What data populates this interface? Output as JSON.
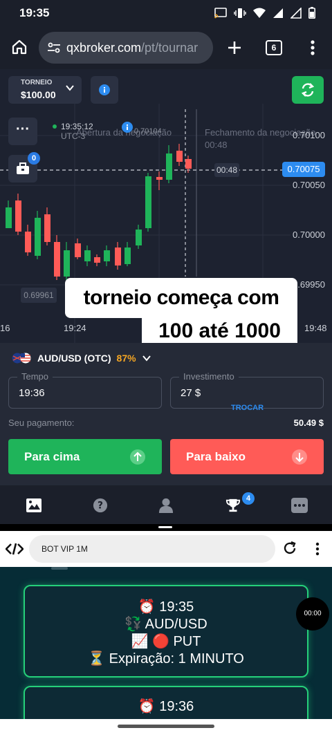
{
  "statusbar": {
    "time": "19:35"
  },
  "browser": {
    "host": "qxbroker.com",
    "path": "/pt/tournar",
    "tab_count": "6"
  },
  "trade": {
    "tournament_label": "TORNEIO",
    "tournament_balance": "$100.00",
    "notif_count": "0",
    "clock_time": "19:35:12",
    "clock_tz": "UTC-3",
    "open_label": "Abertura da negociação",
    "close_label": "Fechamento da negociação",
    "close_time": "00:48",
    "price_flag": "0.70104",
    "current_price": "0.70075",
    "time_badge": "00:48",
    "low_tag": "0.69961",
    "price_ticks": [
      "0.70100",
      "0.70050",
      "0.70000",
      "0.69950"
    ],
    "x_labels": [
      "16",
      "19:24",
      "19:48"
    ]
  },
  "overlay": {
    "line1": "torneio começa com",
    "line2": "100 até  1000"
  },
  "panel": {
    "pair": "AUD/USD (OTC)",
    "payout_pct": "87%",
    "time_label": "Tempo",
    "time_value": "19:36",
    "invest_label": "Investimento",
    "invest_value": "27 $",
    "switch_label": "TROCAR",
    "payment_label": "Seu pagamento:",
    "payment_value": "50.49 $",
    "up_label": "Para cima",
    "down_label": "Para baixo"
  },
  "nav": {
    "trophy_badge": "4"
  },
  "lower": {
    "url": "BOT VIP 1M",
    "timer": "00:00",
    "signal1": {
      "time": "⏰ 19:35",
      "pair": "💱 AUD/USD",
      "dir": "📈 🔴 PUT",
      "exp": "⏳ Expiração: 1 MINUTO"
    },
    "signal2": {
      "time": "⏰ 19:36"
    }
  },
  "colors": {
    "green": "#1fb45a",
    "red": "#ff5b57",
    "blue": "#2d8cf0",
    "card_border": "#25d07a"
  }
}
